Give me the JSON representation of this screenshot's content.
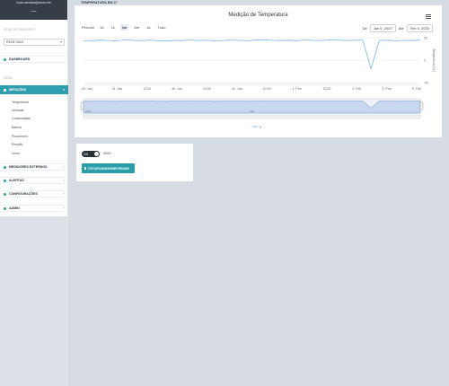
{
  "sidebar": {
    "email": "lucas.zambiasi@unesc.net",
    "dashboard_glyph": "—",
    "network_section": "REDE DE SENSORES",
    "network_selected": "REDE 0003",
    "dashboard_label": "DASHBOARD",
    "menu_section": "MENU",
    "medicoes_label": "MEDIÇÕES",
    "sub_items": [
      "Temperatura",
      "Umidade",
      "Luminosidade",
      "Bateria",
      "Pluviometro",
      "Pressão",
      "Vento"
    ],
    "nav_items": [
      "MEDIDORES EXTERNOS",
      "ALERTAS",
      "CONFIGURAÇÕES",
      "ADMIN"
    ],
    "icons": {
      "home": "home-icon",
      "medicoes": "chart-line-icon",
      "external": "bell-icon",
      "alerts": "bell-icon",
      "config": "gear-icon",
      "admin": "user-icon"
    }
  },
  "header": {
    "page_label": "TEMPERATURA EM C°"
  },
  "chart": {
    "title": "Medição de Temperatura",
    "zoom_label": "Período",
    "zoom_buttons": [
      "1d",
      "1s",
      "1m",
      "6m",
      "1a",
      "Tudo"
    ],
    "zoom_selected": "1m",
    "from_label": "De",
    "from_value": "Jan 6, 2020",
    "to_label": "Até",
    "to_value": "Feb 5, 2020",
    "navigator_start_label": "2020",
    "navigator_mid_label": "Feb",
    "legend_series": "1"
  },
  "chart_data": {
    "type": "line",
    "title": "Medição de Temperatura",
    "ylabel": "Temperatura (°C)",
    "x_ticks": [
      "29. Jan",
      "31. Jan",
      "12:00",
      "30. Jan",
      "12:00",
      "31. Jan",
      "12:00",
      "1. Feb",
      "12:00",
      "2. Feb",
      "4. Feb",
      "5. Feb"
    ],
    "y_ticks": [
      25,
      0,
      -25
    ],
    "ylim": [
      -25,
      25
    ],
    "grid": true,
    "series": [
      {
        "name": "1",
        "values": [
          21.5,
          21.8,
          22.3,
          21.9,
          21.4,
          22.6,
          22.1,
          21.7,
          22.4,
          21.6,
          21.3,
          22.0,
          21.8,
          22.5,
          21.9,
          22.2,
          21.5,
          21.9,
          22.4,
          22.0,
          21.6,
          22.3,
          22.7,
          22.1,
          21.8,
          22.2,
          21.7,
          22.5,
          22.0,
          21.9,
          22.6,
          22.3,
          21.8,
          22.1,
          22.4,
          -9.5,
          21.9,
          22.2,
          21.6,
          22.0,
          21.8,
          22.3
        ]
      }
    ],
    "legend": "bottom-center"
  },
  "controls": {
    "toggle_text": "ON",
    "toggle_value": "0000",
    "button_label": "ESTUFA/ANEMÔMETRO/000"
  },
  "colors": {
    "sidebar_top": "#373e47",
    "accent": "#2e9fb0",
    "series": "#7cb5ec",
    "button": "#2a9fa9"
  }
}
